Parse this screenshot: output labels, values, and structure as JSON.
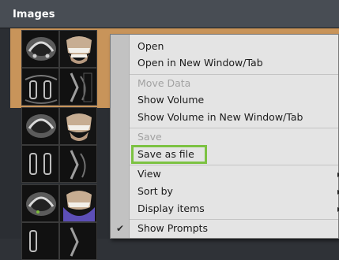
{
  "panel": {
    "title": "Images"
  },
  "thumbnails": [
    {
      "icon": "dental-axial-slice-icon"
    },
    {
      "icon": "dental-3d-volume-icon"
    },
    {
      "icon": "dental-panoramic-slice-icon"
    },
    {
      "icon": "dental-cross-section-icon"
    }
  ],
  "menu": {
    "items": [
      {
        "label": "Open",
        "enabled": true
      },
      {
        "label": "Open in New Window/Tab",
        "enabled": true
      },
      {
        "label": "Move Data",
        "enabled": false
      },
      {
        "label": "Show Volume",
        "enabled": true
      },
      {
        "label": "Show Volume in New Window/Tab",
        "enabled": true
      },
      {
        "label": "Save",
        "enabled": false
      },
      {
        "label": "Save as file",
        "enabled": true,
        "highlighted": true
      },
      {
        "label": "View",
        "enabled": true,
        "submenu": true
      },
      {
        "label": "Sort by",
        "enabled": true,
        "submenu": true
      },
      {
        "label": "Display items",
        "enabled": true,
        "submenu": true
      },
      {
        "label": "Show Prompts",
        "enabled": true,
        "checked": true
      }
    ],
    "check_glyph": "✔",
    "submenu_glyph": "▸"
  },
  "colors": {
    "selection": "#c8945a",
    "highlight_border": "#7cc242",
    "header": "#484d54"
  }
}
